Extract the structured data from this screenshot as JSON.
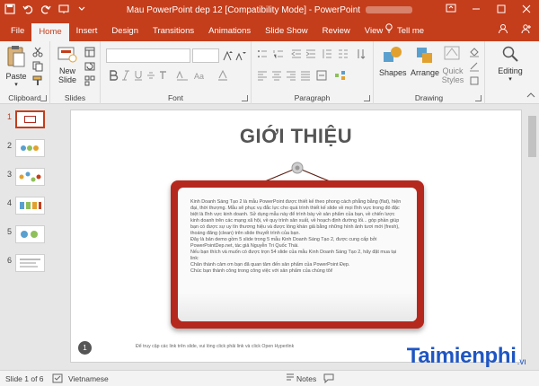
{
  "window": {
    "title": "Mau PowerPoint dep 12 [Compatibility Mode]  -  PowerPoint",
    "controls": [
      "restore-ribbon",
      "minimize",
      "maximize",
      "close"
    ]
  },
  "ribbon_tabs": {
    "items": [
      "File",
      "Home",
      "Insert",
      "Design",
      "Transitions",
      "Animations",
      "Slide Show",
      "Review",
      "View"
    ],
    "active": "Home",
    "tell_me": "Tell me"
  },
  "ribbon": {
    "clipboard": {
      "paste": "Paste",
      "label": "Clipboard"
    },
    "slides": {
      "new_slide_1": "New",
      "new_slide_2": "Slide",
      "label": "Slides"
    },
    "font": {
      "label": "Font"
    },
    "paragraph": {
      "label": "Paragraph"
    },
    "drawing": {
      "shapes": "Shapes",
      "arrange": "Arrange",
      "quick_1": "Quick",
      "quick_2": "Styles",
      "label": "Drawing"
    },
    "editing": {
      "label": "Editing"
    }
  },
  "thumbnails": {
    "numbers": [
      "1",
      "2",
      "3",
      "4",
      "5",
      "6"
    ],
    "selected": "1"
  },
  "slide": {
    "title": "GIỚI THIỆU",
    "body": [
      "Kinh Doanh Sáng Tạo 2 là mẫu PowerPoint được thiết kế theo phong cách phẳng bằng (flat), hiện đại, thời thượng. Mẫu sẽ phục vụ đắc lực cho quá trình thiết kế slide về mọi lĩnh vực trong đó đặc biệt là lĩnh vực kinh doanh. Sử dụng mẫu này để trình bày về sản phẩm của bạn, về chiến lược kinh doanh trên các mạng xã hội, về quy trình sản xuất, về hoạch định đường lối... góp phần giúp bạn có được sự uy tín thương hiệu và được lòng khán giả bằng những hình ảnh tươi mới (fresh), thoáng đãng (clean) trên slide thuyết trình của bạn.",
      "Đây là bản demo gồm 5 slide trong 5 mẫu Kinh Doanh Sáng Tạo 2, được cung cấp bởi PowerPointDep.net, tác giả Nguyễn Tri Quốc Thái.",
      "Nếu bạn thích và muốn có được trọn 54 slide của mẫu Kinh Doanh Sáng Tạo 2, hãy đặt mua tại link:",
      "Chân thành cảm ơn bạn đã quan tâm đến sản phẩm của PowerPoint Đẹp.",
      "Chúc bạn thành công trong công việc với sản phẩm của chúng tôi!"
    ],
    "number": "1",
    "footer": "Để truy cập các link trên slide, vui lòng click phải link và click Open Hyperlink"
  },
  "watermark": {
    "name": "Taimienphi",
    "tld": ".vn"
  },
  "statusbar": {
    "slide_info": "Slide 1 of 6",
    "language": "Vietnamese",
    "notes": "Notes"
  },
  "colors": {
    "accent": "#c43e1c",
    "board_red": "#b5281e",
    "brand_blue": "#1f56c3"
  }
}
